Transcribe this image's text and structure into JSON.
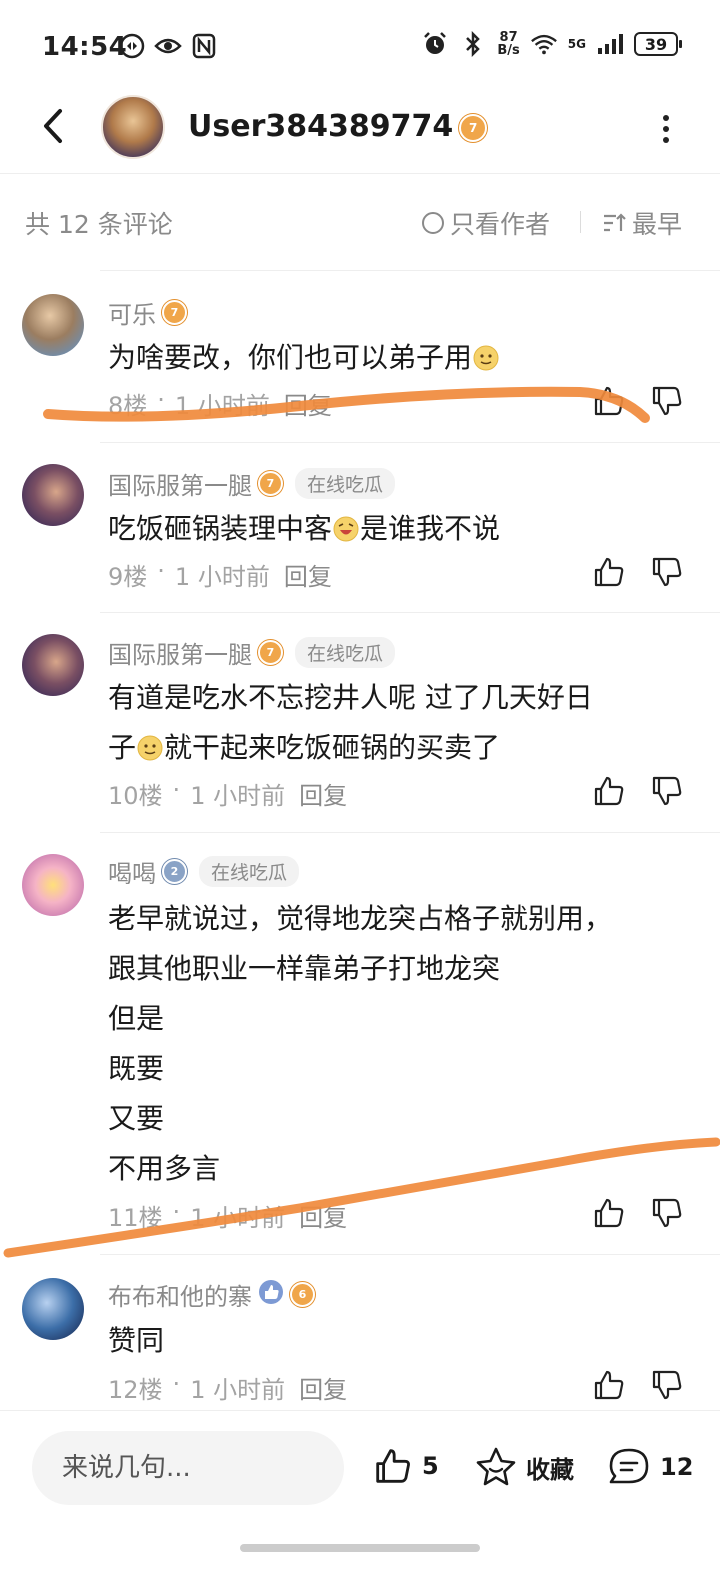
{
  "status_bar": {
    "time": "14:54",
    "net_speed_value": "87",
    "net_speed_unit": "B/s",
    "signal": "5G",
    "battery": "39"
  },
  "header": {
    "username": "User384389774",
    "level": "7",
    "icons": [
      "back-arrow-icon",
      "more-vertical-icon"
    ]
  },
  "filter": {
    "count_label": "共 12 条评论",
    "only_author_label": "只看作者",
    "sort_label": "最早"
  },
  "comments": [
    {
      "name": "可乐",
      "level": "7",
      "tag": "",
      "lines": [
        "为啥要改，你们也可以弟子用"
      ],
      "floor": "8楼",
      "time": "1 小时前",
      "reply": "回复"
    },
    {
      "name": "国际服第一腿",
      "level": "7",
      "tag": "在线吃瓜",
      "lines": [
        "吃饭砸锅装理中客",
        "是谁我不说"
      ],
      "floor": "9楼",
      "time": "1 小时前",
      "reply": "回复"
    },
    {
      "name": "国际服第一腿",
      "level": "7",
      "tag": "在线吃瓜",
      "lines": [
        "有道是吃水不忘挖井人呢 过了几天好日",
        "子",
        "就干起来吃饭砸锅的买卖了"
      ],
      "floor": "10楼",
      "time": "1 小时前",
      "reply": "回复"
    },
    {
      "name": "喝喝",
      "level": "2",
      "tag": "在线吃瓜",
      "lines": [
        "老早就说过，觉得地龙突占格子就别用，",
        "跟其他职业一样靠弟子打地龙突",
        "但是",
        "既要",
        "又要",
        "不用多言"
      ],
      "floor": "11楼",
      "time": "1 小时前",
      "reply": "回复"
    },
    {
      "name": "布布和他的寨",
      "level": "6",
      "tag": "",
      "lines": [
        "赞同"
      ],
      "floor": "12楼",
      "time": "1 小时前",
      "reply": "回复"
    }
  ],
  "bottom_bar": {
    "input_placeholder": "来说几句...",
    "like_count": "5",
    "favorite_label": "收藏",
    "comment_count": "12"
  },
  "colors": {
    "annotation_stroke": "#f08a3c",
    "badge_orange": "#f0a64a",
    "muted_text": "#8a8a8a"
  }
}
